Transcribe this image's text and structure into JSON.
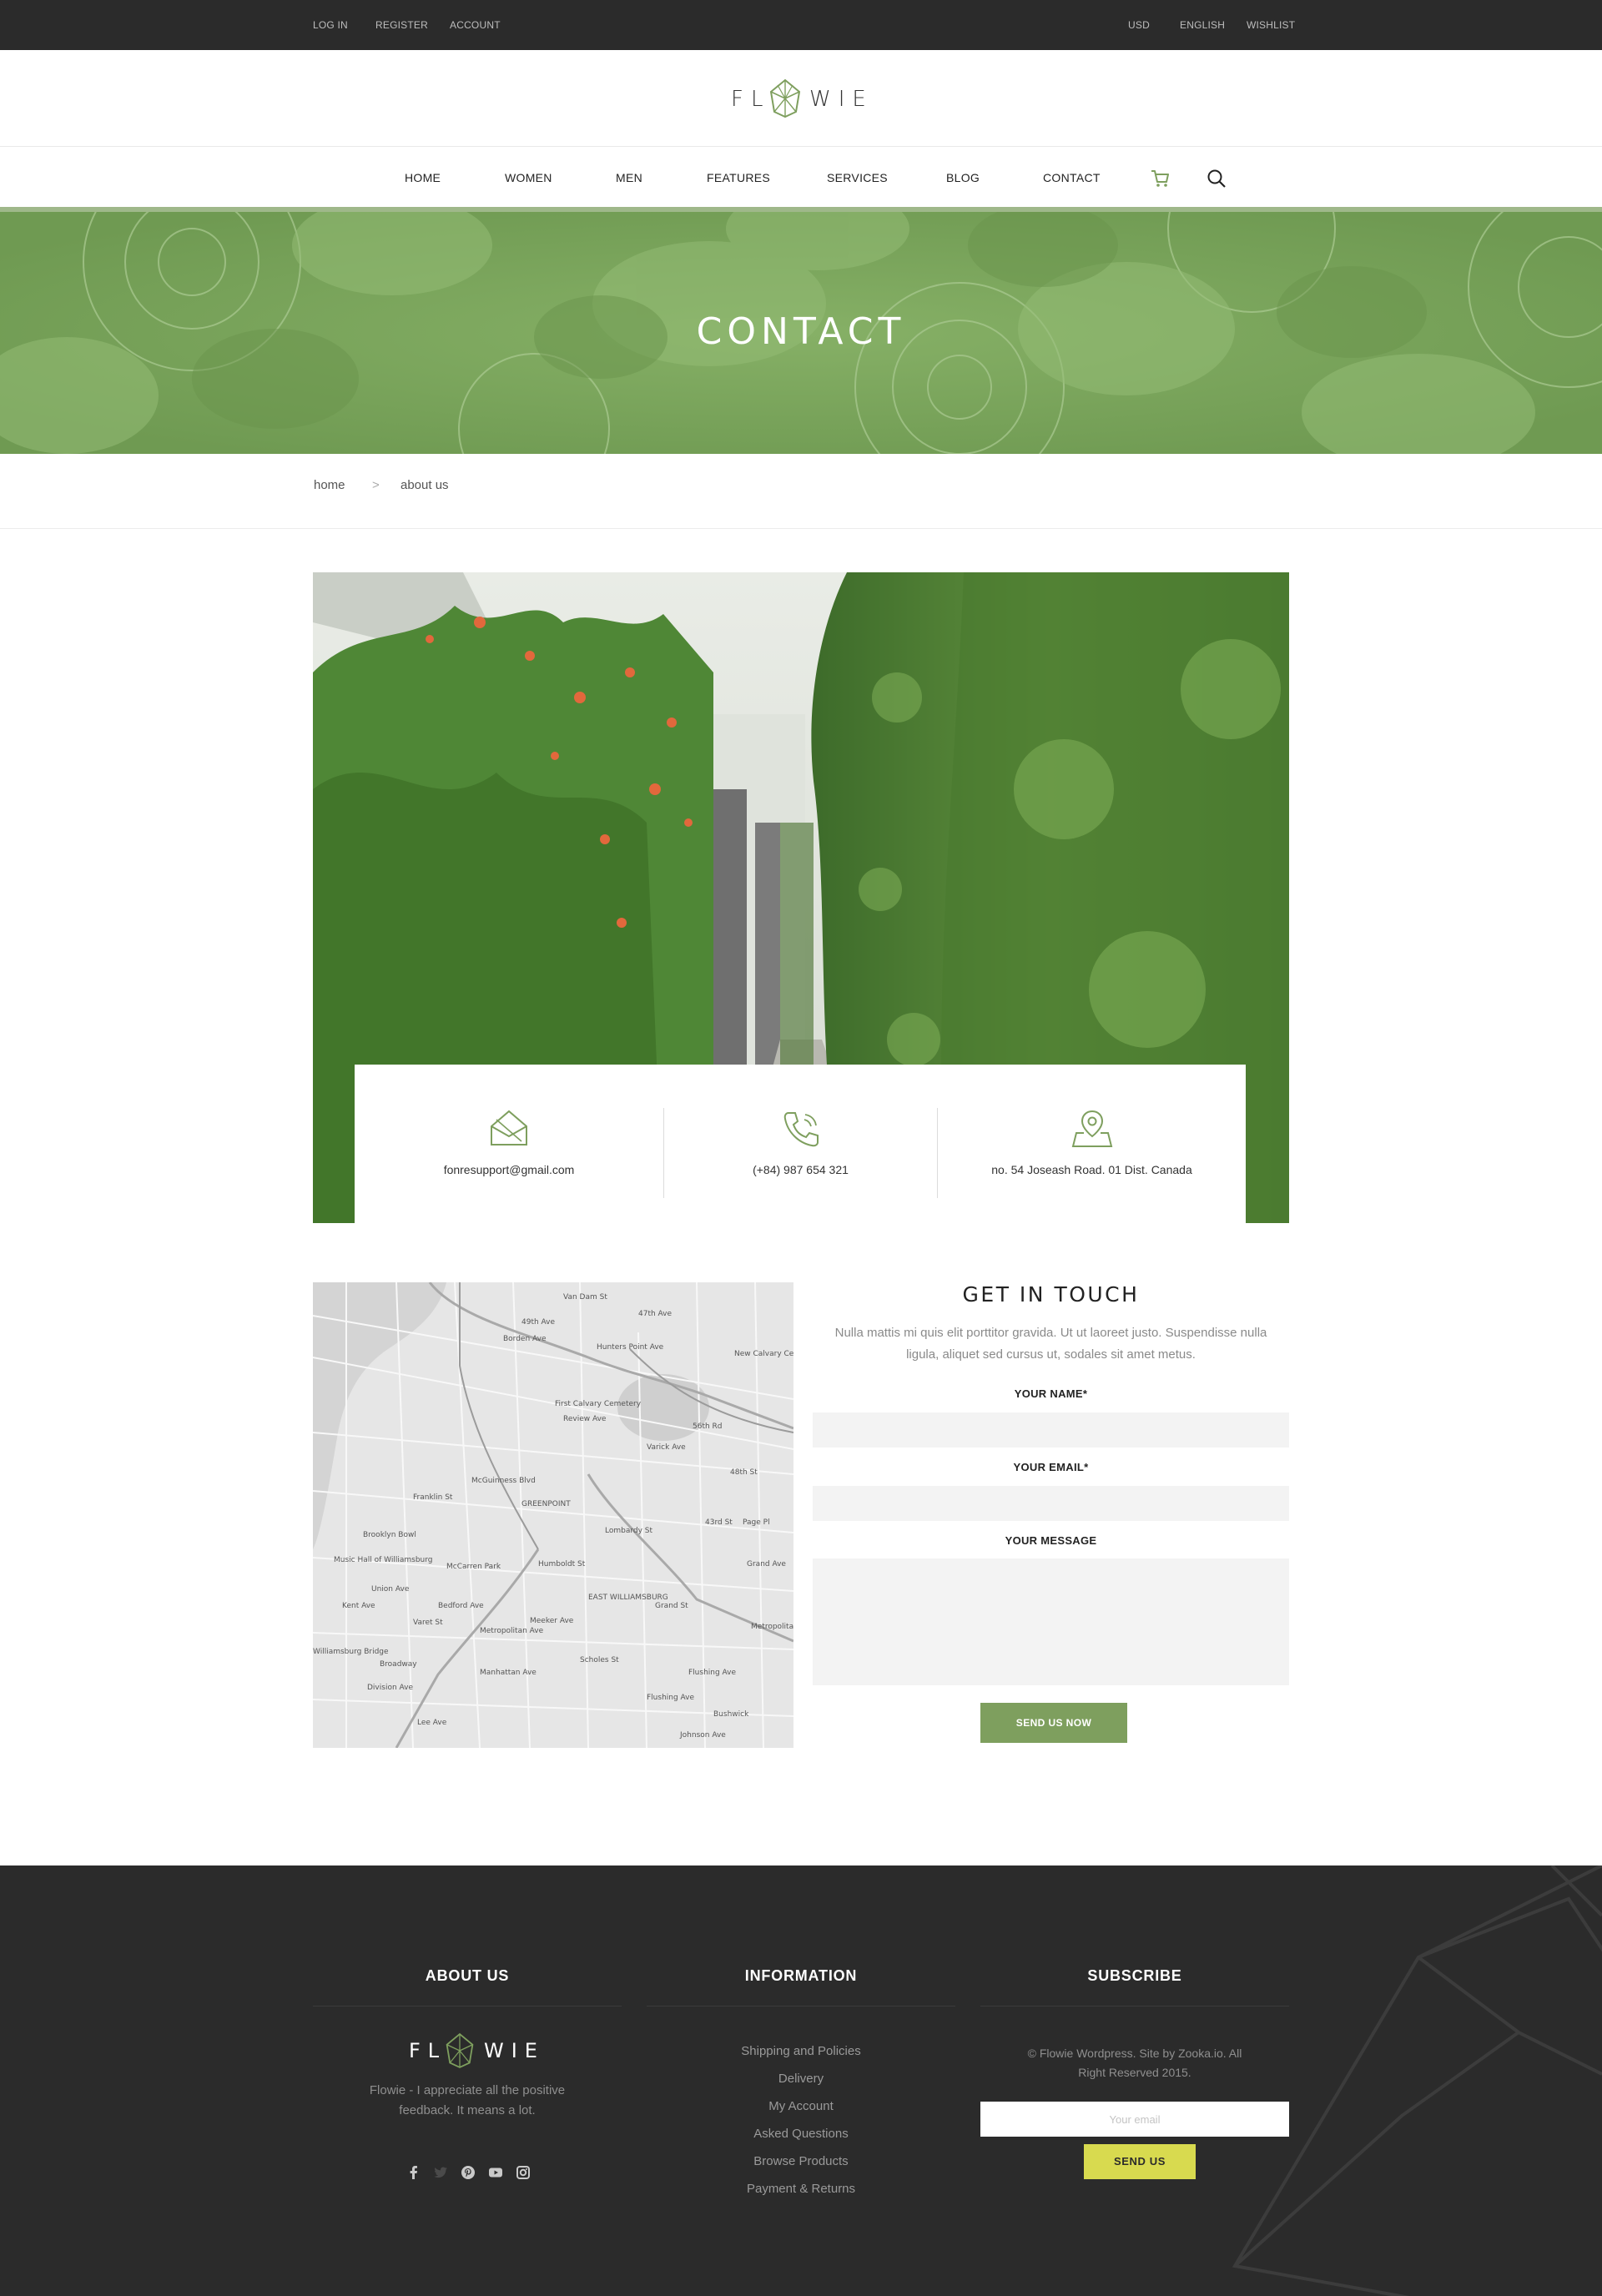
{
  "topbar": {
    "login": "LOG IN",
    "register": "REGISTER",
    "account": "ACCOUNT",
    "currency": "USD",
    "language": "ENGLISH",
    "wishlist": "WISHLIST"
  },
  "brand": {
    "left": "FL",
    "right": "WIE",
    "icon": "leaf-crystal-logo",
    "accent_color": "#7e9f5e",
    "dark_color": "#2b2b2b",
    "subscribe_color": "#d8da4f"
  },
  "nav": {
    "items": [
      "HOME",
      "WOMEN",
      "MEN",
      "FEATURES",
      "SERVICES",
      "BLOG",
      "CONTACT"
    ],
    "cart_icon": "cart-icon",
    "search_icon": "search-icon"
  },
  "hero": {
    "title": "CONTACT"
  },
  "breadcrumb": {
    "home": "home",
    "separator": ">",
    "current": "about us"
  },
  "contact_info": {
    "email": "fonresupport@gmail.com",
    "phone": "(+84) 987 654 321",
    "address": "no. 54 Joseash Road. 01 Dist. Canada"
  },
  "map": {
    "labels": [
      "49th Ave",
      "47th Ave",
      "Borden Ave",
      "Hunters Point Ave",
      "New Calvary Cem",
      "First Calvary Cemetery",
      "Review Ave",
      "GREENPOINT",
      "Brooklyn Bowl",
      "Music Hall of Williamsburg",
      "McCarren Park",
      "EAST WILLIAMSBURG",
      "Grand St",
      "Metropolitan",
      "Broadway",
      "Division Ave",
      "Flushing Ave",
      "Meeker Ave",
      "Scholes St",
      "Bushwick",
      "Humboldt St",
      "Manhattan Ave",
      "Franklin St",
      "Kent Ave",
      "Lombardy St",
      "Varick Ave",
      "Grand Ave",
      "56th Rd",
      "48th St",
      "43rd St",
      "Page Pl",
      "Flushing Ave",
      "Metropolitan Ave",
      "Johnson Ave",
      "Varet St",
      "Williamsburg Bridge",
      "Lee Ave",
      "Union Ave",
      "Bedford Ave",
      "McGuinness Blvd",
      "Van Dam St"
    ]
  },
  "form": {
    "title": "GET IN TOUCH",
    "intro": "Nulla mattis mi quis elit porttitor gravida. Ut ut laoreet justo. Suspendisse nulla ligula, aliquet sed cursus ut, sodales sit amet metus.",
    "name_label": "YOUR NAME*",
    "email_label": "YOUR EMAIL*",
    "message_label": "YOUR MESSAGE",
    "name_value": "",
    "email_value": "",
    "message_value": "",
    "submit": "SEND US NOW"
  },
  "footer": {
    "about": {
      "title": "ABOUT US",
      "text": "Flowie - I appreciate all the positive feedback. It means a lot.",
      "social": [
        "facebook-icon",
        "twitter-icon",
        "pinterest-icon",
        "youtube-icon",
        "instagram-icon"
      ]
    },
    "information": {
      "title": "INFORMATION",
      "links": [
        "Shipping and Policies",
        "Delivery",
        "My Account",
        "Asked Questions",
        "Browse Products",
        "Payment & Returns"
      ]
    },
    "subscribe": {
      "title": "SUBSCRIBE",
      "copyright": "© Flowie Wordpress. Site by Zooka.io. All Right Reserved 2015.",
      "placeholder": "Your email",
      "email_value": "",
      "button": "SEND US"
    }
  }
}
